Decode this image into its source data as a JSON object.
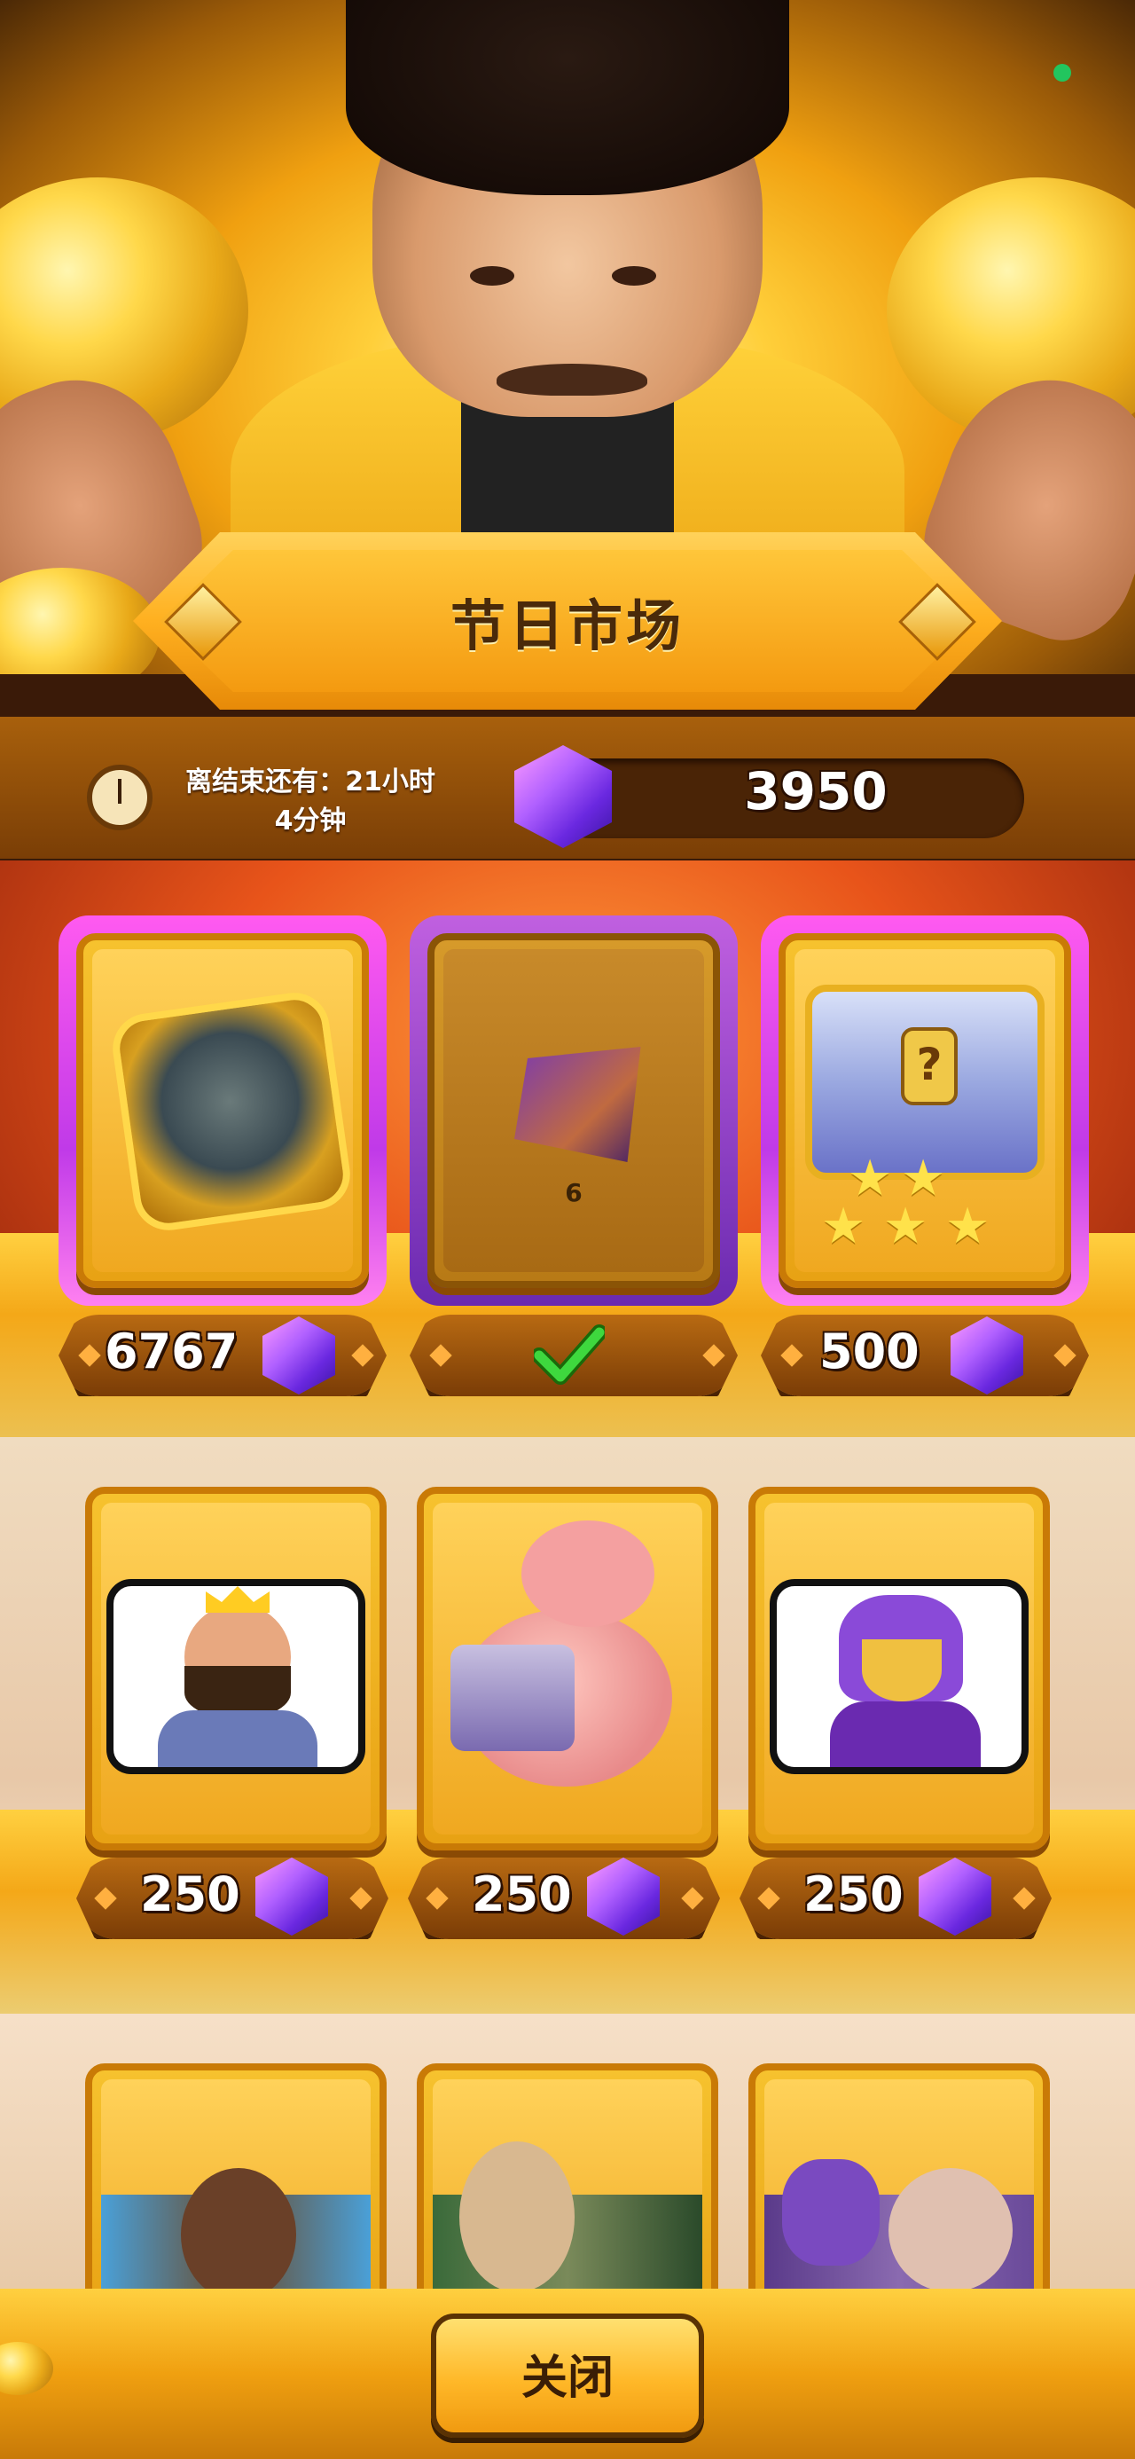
{
  "header": {
    "title": "节日市场",
    "timer_line1": "离结束还有：21小时",
    "timer_line2": "4分钟",
    "gem_balance": "3950",
    "status_dot_color": "#22c55e"
  },
  "featured_offers": [
    {
      "item": "armored-hero-card",
      "price": "6767",
      "currency": "gem",
      "state": "available"
    },
    {
      "item": "masked-hero-card",
      "quantity": "6",
      "state": "purchased",
      "purchased_mark": "check-icon"
    },
    {
      "item": "star-chest",
      "stars": 3,
      "price": "500",
      "currency": "gem",
      "state": "available"
    }
  ],
  "emote_offers": [
    {
      "item": "king-emote",
      "price": "250",
      "currency": "gem"
    },
    {
      "item": "hog-rider-emote",
      "price": "250",
      "currency": "gem"
    },
    {
      "item": "purple-warrior-emote",
      "price": "250",
      "currency": "gem"
    }
  ],
  "banner_offers": [
    {
      "item": "bear-rider-banner"
    },
    {
      "item": "bear-guard-banner"
    },
    {
      "item": "purple-squad-banner"
    }
  ],
  "footer": {
    "close_label": "关闭"
  },
  "colors": {
    "gem_purple": "#b060ff",
    "gold": "#ffc63a",
    "check_green": "#2fcf2f"
  }
}
